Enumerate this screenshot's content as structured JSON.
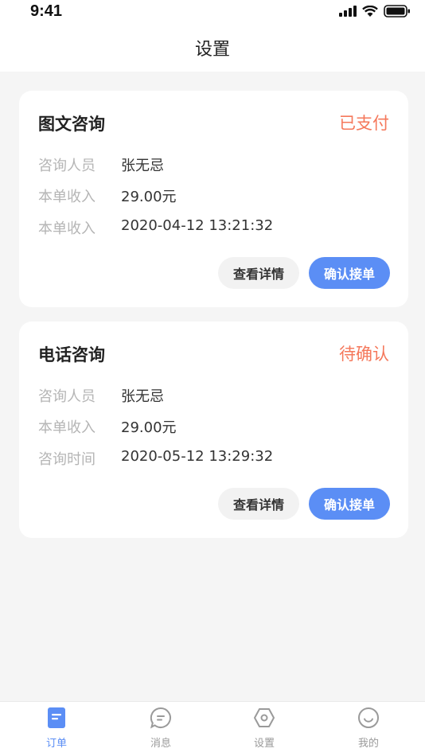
{
  "status_bar": {
    "time": "9:41"
  },
  "header": {
    "title": "设置"
  },
  "colors": {
    "accent": "#5b8ef5",
    "status": "#f5785b"
  },
  "orders": [
    {
      "title": "图文咨询",
      "status": "已支付",
      "rows": [
        {
          "label": "咨询人员",
          "value": "张无忌"
        },
        {
          "label": "本单收入",
          "value": "29.00元"
        },
        {
          "label": "本单收入",
          "value": "2020-04-12 13:21:32"
        }
      ],
      "detail_label": "查看详情",
      "confirm_label": "确认接单"
    },
    {
      "title": "电话咨询",
      "status": "待确认",
      "rows": [
        {
          "label": "咨询人员",
          "value": "张无忌"
        },
        {
          "label": "本单收入",
          "value": "29.00元"
        },
        {
          "label": "咨询时间",
          "value": "2020-05-12 13:29:32"
        }
      ],
      "detail_label": "查看详情",
      "confirm_label": "确认接单"
    }
  ],
  "tabbar": [
    {
      "label": "订单",
      "icon": "order-icon",
      "active": true
    },
    {
      "label": "消息",
      "icon": "message-icon",
      "active": false
    },
    {
      "label": "设置",
      "icon": "settings-icon",
      "active": false
    },
    {
      "label": "我的",
      "icon": "profile-icon",
      "active": false
    }
  ]
}
